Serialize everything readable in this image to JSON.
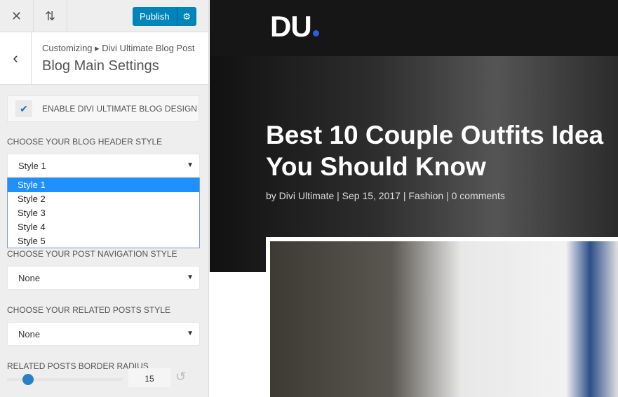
{
  "toolbar": {
    "close_icon": "close-icon",
    "reorder_icon": "arrows-up-down-icon",
    "publish_label": "Publish",
    "settings_icon": "gear-icon",
    "accent": "#0085ba"
  },
  "header": {
    "breadcrumb": "Customizing ▸ Divi Ultimate Blog Post",
    "title": "Blog Main Settings"
  },
  "controls": {
    "enable": {
      "label": "ENABLE DIVI ULTIMATE BLOG DESIGN",
      "checked": true
    },
    "header_style": {
      "label": "CHOOSE YOUR BLOG HEADER STYLE",
      "value": "Style 1",
      "options": [
        "Style 1",
        "Style 2",
        "Style 3",
        "Style 4",
        "Style 5"
      ]
    },
    "nav_style": {
      "label": "CHOOSE YOUR POST NAVIGATION STYLE",
      "value": "None"
    },
    "related_style": {
      "label": "CHOOSE YOUR RELATED POSTS STYLE",
      "value": "None"
    },
    "radius": {
      "label": "RELATED POSTS BORDER RADIUS",
      "value": "15"
    }
  },
  "preview": {
    "logo": "DU",
    "title_line1": "Best 10 Couple Outfits Idea",
    "title_line2": "You Should Know",
    "meta": "by Divi Ultimate | Sep 15, 2017 | Fashion | 0 comments"
  }
}
